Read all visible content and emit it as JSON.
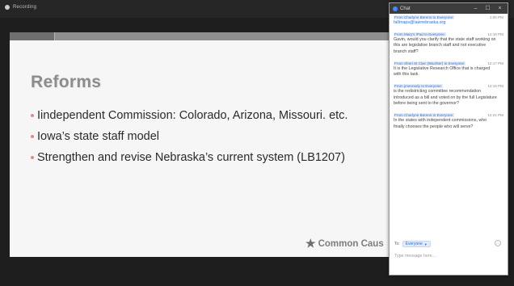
{
  "meeting": {
    "recording_label": "Recording"
  },
  "slide": {
    "title": "Reforms",
    "bullets": [
      "Iindependent Commission: Colorado, Arizona, Missouri. etc.",
      "Iowa’s state staff model",
      "Strengthen and revise Nebraska’s current system (LB1207)"
    ],
    "logo_text": "Common Caus",
    "logo_icon": "star-icon"
  },
  "chat": {
    "window_title": "Chat",
    "controls": {
      "minimize": "–",
      "maximize": "☐",
      "close": "×"
    },
    "messages": [
      {
        "sender": "From Charlyne Berens to Everyone:",
        "time": "1:00 PM",
        "text": "fallrnaps@lawnebraska.org",
        "is_link": true
      },
      {
        "sender": "From Mary's iPad to Everyone:",
        "time": "12:16 PM",
        "text": "Gavin, would you clarify that the state staff working on this are legislative branch staff and not executive branch staff?",
        "is_link": false
      },
      {
        "sender": "From Sheri St Clair (Wachter) to Everyone:",
        "time": "12:17 PM",
        "text": "It is the Legislative Research Office that is charged with this task.",
        "is_link": false
      },
      {
        "sender": "From jmennedy to Everyone:",
        "time": "12:19 PM",
        "text": "is the redistricting committee recommendation introduced as a bill and voted on by the full Legislature before being sent to the governor?",
        "is_link": false
      },
      {
        "sender": "From Charlyne Berens to Everyone:",
        "time": "12:21 PM",
        "text": "In the states with independent commissions, who finally chooses the people who will serve?",
        "is_link": false
      }
    ],
    "composer": {
      "to_label": "To:",
      "recipient": "Everyone",
      "more_label": "…",
      "placeholder": "Type message here..."
    }
  }
}
